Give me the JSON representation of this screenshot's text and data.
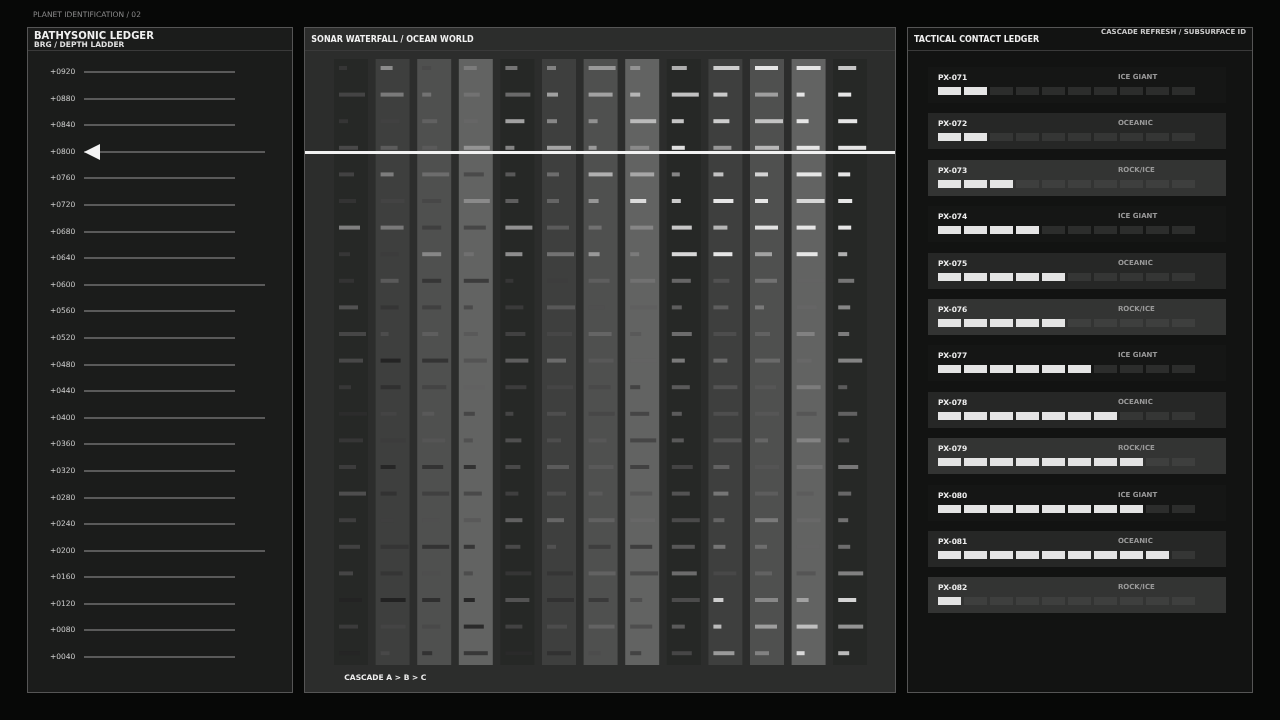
{
  "breadcrumb": "PLANET IDENTIFICATION / 02",
  "depth_panel": {
    "title": "BATHYSONIC LEDGER",
    "subtitle": "BRG / DEPTH LADDER",
    "ticks": [
      {
        "label": "+0920",
        "major": false,
        "selected": false
      },
      {
        "label": "+0880",
        "major": false,
        "selected": false
      },
      {
        "label": "+0840",
        "major": false,
        "selected": false
      },
      {
        "label": "+0800",
        "major": true,
        "selected": true
      },
      {
        "label": "+0760",
        "major": false,
        "selected": false
      },
      {
        "label": "+0720",
        "major": false,
        "selected": false
      },
      {
        "label": "+0680",
        "major": false,
        "selected": false
      },
      {
        "label": "+0640",
        "major": false,
        "selected": false
      },
      {
        "label": "+0600",
        "major": true,
        "selected": false
      },
      {
        "label": "+0560",
        "major": false,
        "selected": false
      },
      {
        "label": "+0520",
        "major": false,
        "selected": false
      },
      {
        "label": "+0480",
        "major": false,
        "selected": false
      },
      {
        "label": "+0440",
        "major": false,
        "selected": false
      },
      {
        "label": "+0400",
        "major": true,
        "selected": false
      },
      {
        "label": "+0360",
        "major": false,
        "selected": false
      },
      {
        "label": "+0320",
        "major": false,
        "selected": false
      },
      {
        "label": "+0280",
        "major": false,
        "selected": false
      },
      {
        "label": "+0240",
        "major": false,
        "selected": false
      },
      {
        "label": "+0200",
        "major": true,
        "selected": false
      },
      {
        "label": "+0160",
        "major": false,
        "selected": false
      },
      {
        "label": "+0120",
        "major": false,
        "selected": false
      },
      {
        "label": "+0080",
        "major": false,
        "selected": false
      },
      {
        "label": "+0040",
        "major": false,
        "selected": false
      }
    ]
  },
  "waterfall_panel": {
    "title": "SONAR WATERFALL / OCEAN WORLD",
    "footer": "CASCADE A > B > C"
  },
  "contact_panel": {
    "title": "TACTICAL CONTACT LEDGER",
    "caption": "CASCADE REFRESH / SUBSURFACE ID",
    "contacts": [
      {
        "id": "PX-071",
        "class": "ICE GIANT",
        "level": 0.2
      },
      {
        "id": "PX-072",
        "class": "OCEANIC",
        "level": 0.2
      },
      {
        "id": "PX-073",
        "class": "ROCK/ICE",
        "level": 0.3
      },
      {
        "id": "PX-074",
        "class": "ICE GIANT",
        "level": 0.4
      },
      {
        "id": "PX-075",
        "class": "OCEANIC",
        "level": 0.5
      },
      {
        "id": "PX-076",
        "class": "ROCK/ICE",
        "level": 0.5
      },
      {
        "id": "PX-077",
        "class": "ICE GIANT",
        "level": 0.6
      },
      {
        "id": "PX-078",
        "class": "OCEANIC",
        "level": 0.7
      },
      {
        "id": "PX-079",
        "class": "ROCK/ICE",
        "level": 0.8
      },
      {
        "id": "PX-080",
        "class": "ICE GIANT",
        "level": 0.8
      },
      {
        "id": "PX-081",
        "class": "OCEANIC",
        "level": 0.9
      },
      {
        "id": "PX-082",
        "class": "ROCK/ICE",
        "level": 0.1
      }
    ]
  }
}
